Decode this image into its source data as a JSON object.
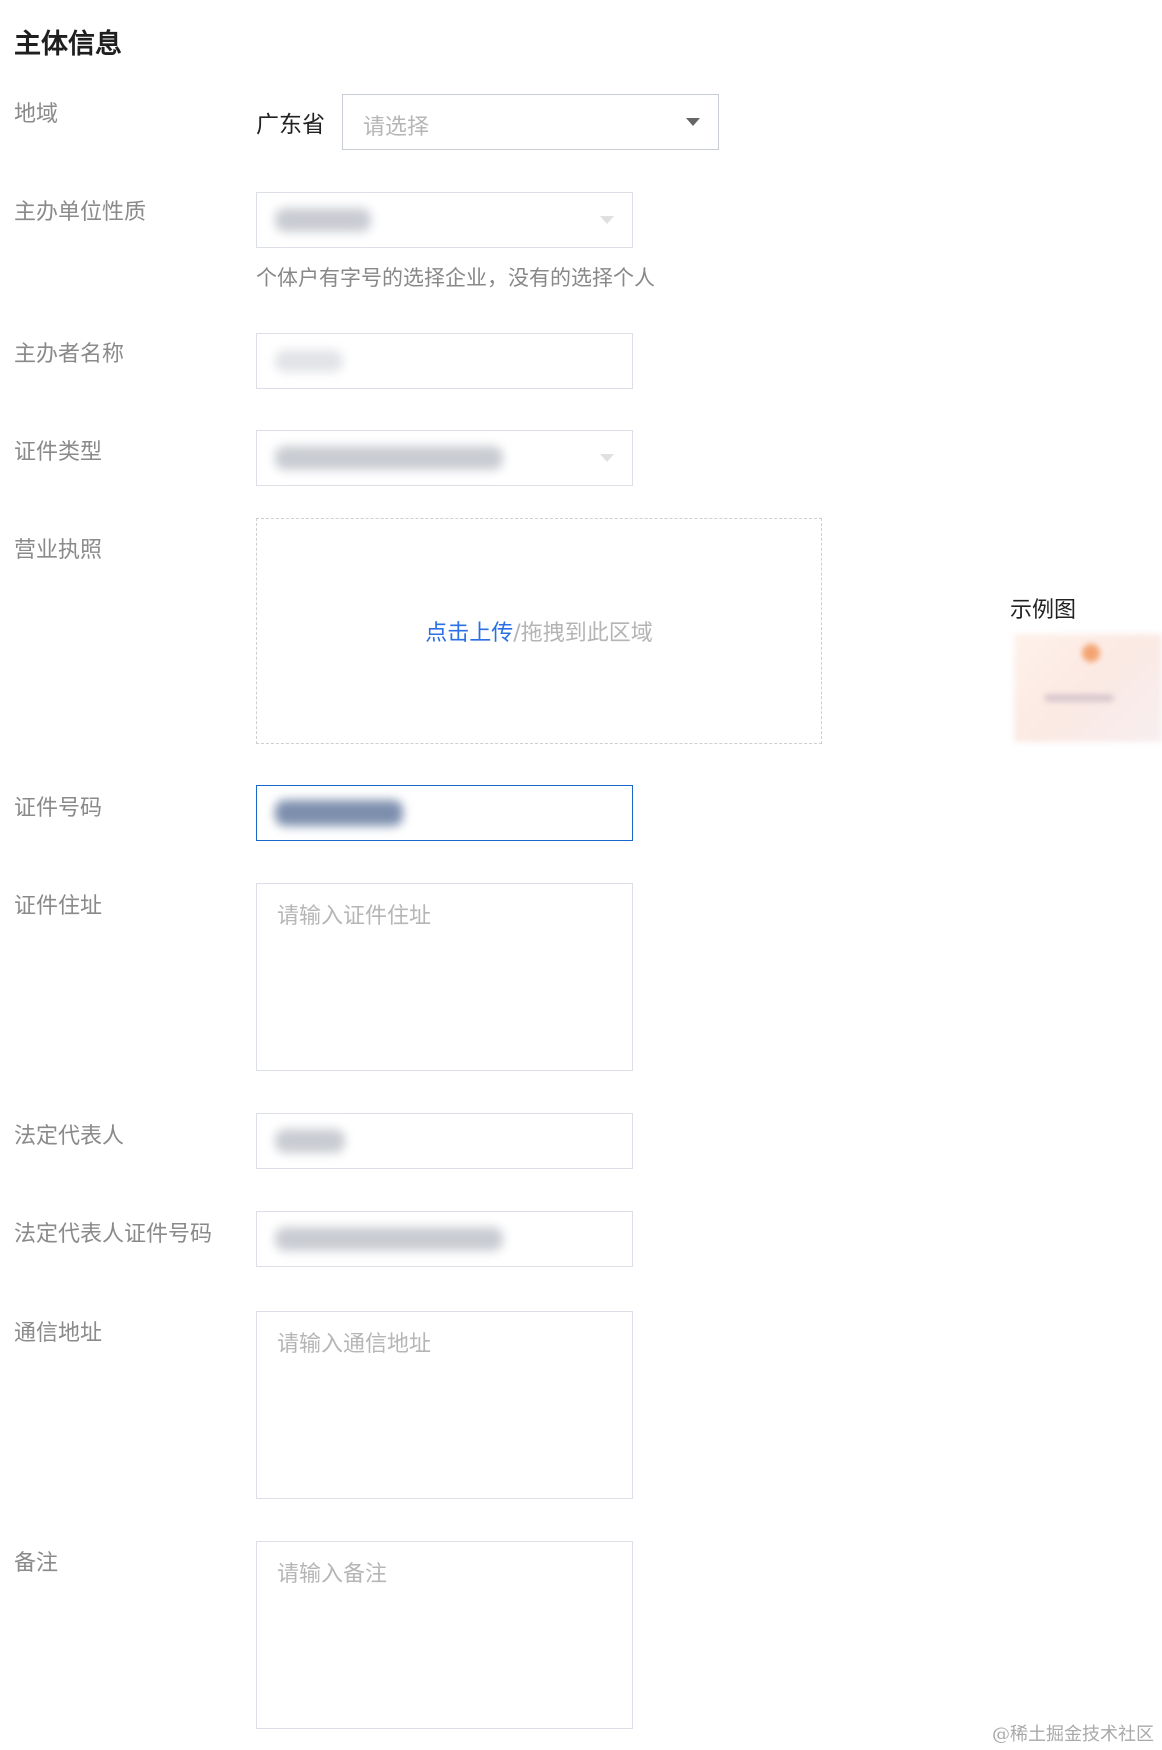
{
  "section": {
    "title": "主体信息"
  },
  "region": {
    "label": "地域",
    "province": "广东省",
    "city_select": {
      "placeholder": "请选择"
    }
  },
  "org_nature": {
    "label": "主办单位性质",
    "hint": "个体户有字号的选择企业，没有的选择个人"
  },
  "sponsor_name": {
    "label": "主办者名称"
  },
  "cert_type": {
    "label": "证件类型"
  },
  "business_license": {
    "label": "营业执照",
    "upload_link": "点击上传",
    "upload_rest": "/拖拽到此区域",
    "example_label": "示例图"
  },
  "cert_number": {
    "label": "证件号码"
  },
  "cert_address": {
    "label": "证件住址",
    "placeholder": "请输入证件住址"
  },
  "legal_rep": {
    "label": "法定代表人"
  },
  "legal_rep_cert": {
    "label": "法定代表人证件号码"
  },
  "mail_address": {
    "label": "通信地址",
    "placeholder": "请输入通信地址"
  },
  "remark": {
    "label": "备注",
    "placeholder": "请输入备注"
  },
  "watermark": "@稀土掘金技术社区",
  "colors": {
    "accent": "#2b6fe6",
    "focus_border": "#1b67c9",
    "label": "#8a8a8a",
    "border": "#dcdfe6"
  },
  "icons": [
    "chevron-down-icon"
  ]
}
